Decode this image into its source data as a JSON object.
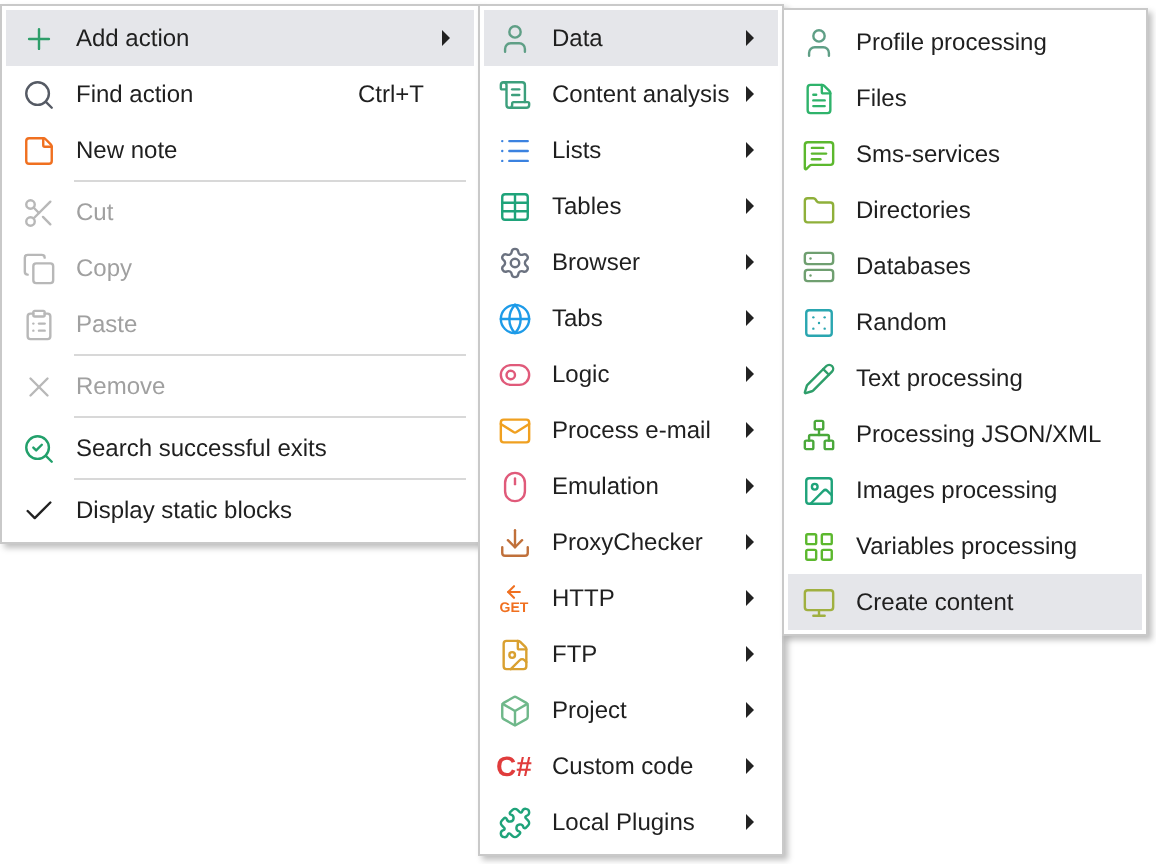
{
  "main_menu": {
    "sections": [
      [
        {
          "label": "Add action",
          "submenu": true,
          "disabled": false,
          "checked": false,
          "selected": true
        },
        {
          "label": "Find action",
          "shortcut": "Ctrl+T",
          "submenu": false,
          "disabled": false,
          "checked": false,
          "selected": false
        },
        {
          "label": "New note",
          "submenu": false,
          "disabled": false,
          "checked": false,
          "selected": false
        }
      ],
      [
        {
          "label": "Cut",
          "submenu": false,
          "disabled": true,
          "checked": false,
          "selected": false
        },
        {
          "label": "Copy",
          "submenu": false,
          "disabled": true,
          "checked": false,
          "selected": false
        },
        {
          "label": "Paste",
          "submenu": false,
          "disabled": true,
          "checked": false,
          "selected": false
        }
      ],
      [
        {
          "label": "Remove",
          "submenu": false,
          "disabled": true,
          "checked": false,
          "selected": false
        }
      ],
      [
        {
          "label": "Search successful exits",
          "submenu": false,
          "disabled": false,
          "checked": false,
          "selected": false
        }
      ],
      [
        {
          "label": "Display static blocks",
          "submenu": false,
          "disabled": false,
          "checked": true,
          "selected": false
        }
      ]
    ]
  },
  "action_menu": {
    "items": [
      {
        "label": "Data",
        "selected": true
      },
      {
        "label": "Content analysis",
        "selected": false
      },
      {
        "label": "Lists",
        "selected": false
      },
      {
        "label": "Tables",
        "selected": false
      },
      {
        "label": "Browser",
        "selected": false
      },
      {
        "label": "Tabs",
        "selected": false
      },
      {
        "label": "Logic",
        "selected": false
      },
      {
        "label": "Process e-mail",
        "selected": false
      },
      {
        "label": "Emulation",
        "selected": false
      },
      {
        "label": "ProxyChecker",
        "selected": false
      },
      {
        "label": "HTTP",
        "selected": false,
        "icon_text": "GET"
      },
      {
        "label": "FTP",
        "selected": false
      },
      {
        "label": "Project",
        "selected": false
      },
      {
        "label": "Custom code",
        "selected": false,
        "icon_text": "C#"
      },
      {
        "label": "Local Plugins",
        "selected": false
      }
    ]
  },
  "data_menu": {
    "items": [
      {
        "label": "Profile processing",
        "selected": false
      },
      {
        "label": "Files",
        "selected": false
      },
      {
        "label": "Sms-services",
        "selected": false
      },
      {
        "label": "Directories",
        "selected": false
      },
      {
        "label": "Databases",
        "selected": false
      },
      {
        "label": "Random",
        "selected": false
      },
      {
        "label": "Text processing",
        "selected": false
      },
      {
        "label": "Processing JSON/XML",
        "selected": false
      },
      {
        "label": "Images processing",
        "selected": false
      },
      {
        "label": "Variables processing",
        "selected": false
      },
      {
        "label": "Create content",
        "selected": true
      }
    ]
  }
}
